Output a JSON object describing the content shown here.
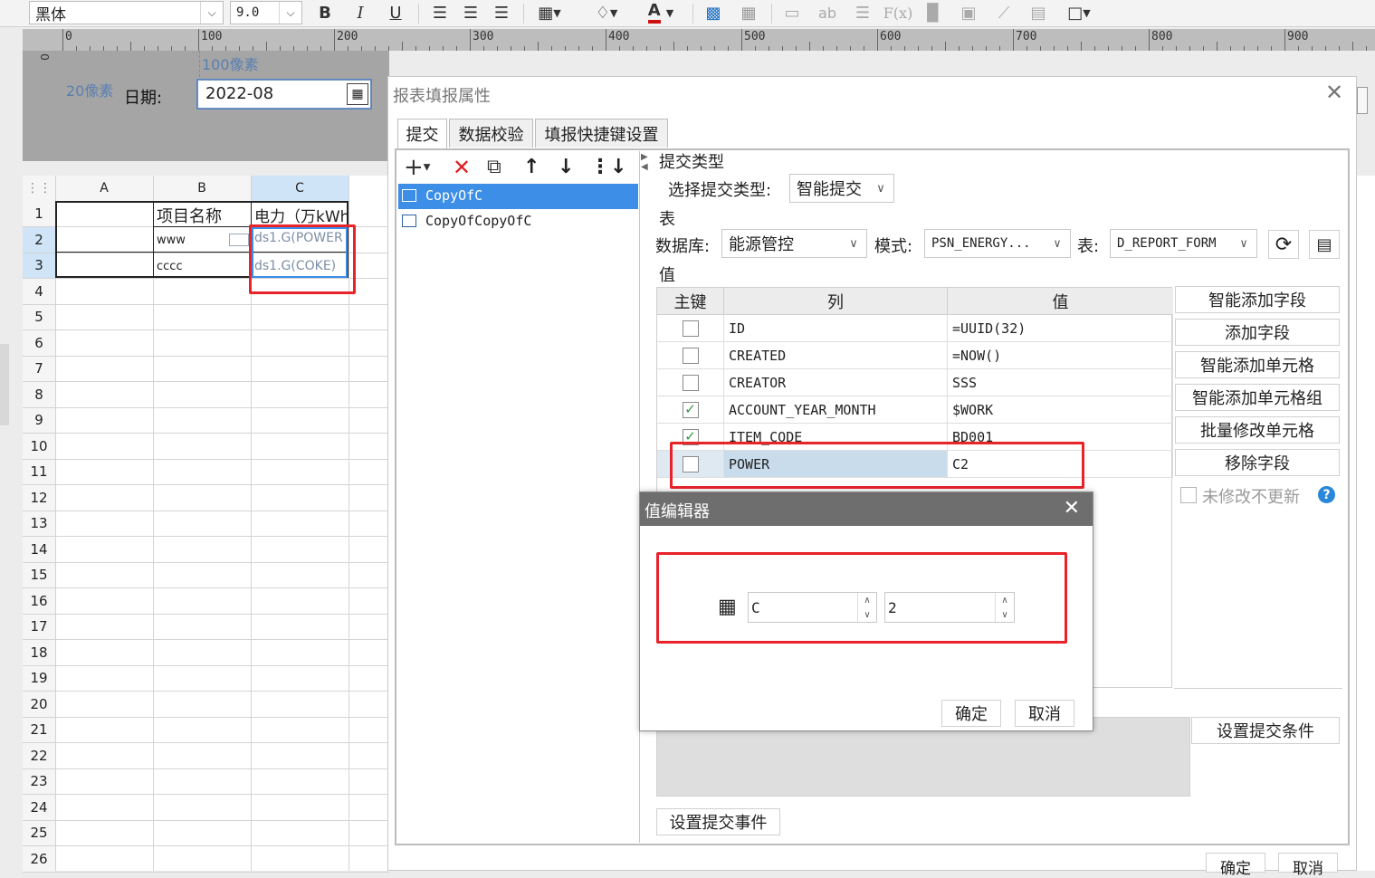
{
  "toolbar": {
    "font_name": "黑体",
    "font_size": "9.0",
    "bold": "B",
    "italic": "I",
    "underline": "U",
    "font_color_letter": "A",
    "text_ab": "ab",
    "formula": "F(x)"
  },
  "ruler": {
    "labels": [
      "0",
      "100",
      "200",
      "300",
      "400",
      "500",
      "600",
      "700",
      "800",
      "900"
    ],
    "side_label": "0"
  },
  "design": {
    "px100_label": "100像素",
    "px20_label": "20像素",
    "date_label": "日期:",
    "date_value": "2022-08"
  },
  "sheet": {
    "columns": [
      "A",
      "B",
      "C"
    ],
    "rows": [
      "1",
      "2",
      "3",
      "4",
      "5",
      "6",
      "7",
      "8",
      "9",
      "10",
      "11",
      "12",
      "13",
      "14",
      "15",
      "16",
      "17",
      "18",
      "19",
      "20",
      "21",
      "22",
      "23",
      "24",
      "25",
      "26"
    ],
    "b1": "项目名称",
    "c1": "电力（万kWh",
    "b2": "www",
    "c2": "ds1.G(POWER",
    "b3": "cccc",
    "c3": "ds1.G(COKE)"
  },
  "dialog": {
    "title": "报表填报属性",
    "tabs": [
      "提交",
      "数据校验",
      "填报快捷键设置"
    ],
    "list_items": [
      "CopyOfC",
      "CopyOfCopyOfC"
    ],
    "submit_type_section": "提交类型",
    "select_submit_type_label": "选择提交类型:",
    "submit_type_value": "智能提交",
    "table_section": "表",
    "database_label": "数据库:",
    "database_value": "能源管控",
    "schema_label": "模式:",
    "schema_value": "PSN_ENERGY...",
    "table_label": "表:",
    "table_value": "D_REPORT_FORM",
    "value_section": "值",
    "grid_headers": [
      "主键",
      "列",
      "值"
    ],
    "fields": [
      {
        "key": false,
        "column": "ID",
        "value": "=UUID(32)"
      },
      {
        "key": false,
        "column": "CREATED",
        "value": "=NOW()"
      },
      {
        "key": false,
        "column": "CREATOR",
        "value": "SSS"
      },
      {
        "key": true,
        "column": "ACCOUNT_YEAR_MONTH",
        "value": "$WORK"
      },
      {
        "key": true,
        "column": "ITEM_CODE",
        "value": "BD001"
      },
      {
        "key": false,
        "column": "POWER",
        "value": "C2"
      }
    ],
    "side_buttons": [
      "智能添加字段",
      "添加字段",
      "智能添加单元格",
      "智能添加单元格组",
      "批量修改单元格",
      "移除字段"
    ],
    "no_update_label": "未修改不更新",
    "set_condition_button": "设置提交条件",
    "set_event_button": "设置提交事件",
    "ok_button": "确定",
    "cancel_button": "取消"
  },
  "value_editor": {
    "title": "值编辑器",
    "column_value": "C",
    "row_value": "2",
    "ok_button": "确定",
    "cancel_button": "取消"
  },
  "colors": {
    "selection_blue": "#3c8ee6",
    "highlight_red": "#e8232a",
    "check_green": "#2e9b3e",
    "editor_title_bg": "#6e6e6e"
  }
}
